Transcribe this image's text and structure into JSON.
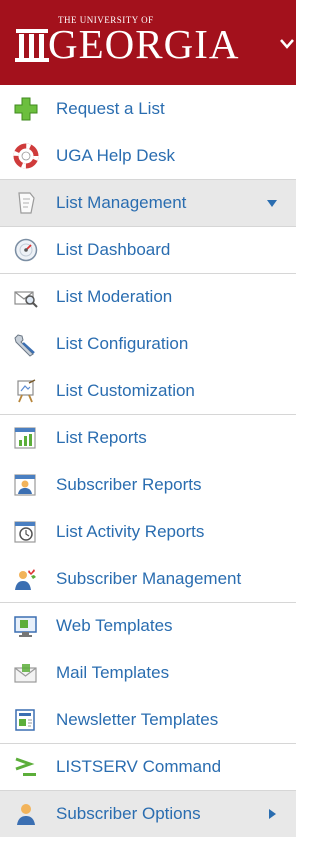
{
  "header": {
    "univ_of": "THE UNIVERSITY OF",
    "georgia": "GEORGIA"
  },
  "menu": [
    {
      "label": "Request a List",
      "icon": "plus-icon"
    },
    {
      "label": "UGA Help Desk",
      "icon": "lifebuoy-icon"
    },
    {
      "label": "List Management",
      "icon": "paper-icon"
    },
    {
      "label": "List Dashboard",
      "icon": "dashboard-gauge-icon"
    },
    {
      "label": "List Moderation",
      "icon": "envelope-magnifier-icon"
    },
    {
      "label": "List Configuration",
      "icon": "wrench-icon"
    },
    {
      "label": "List Customization",
      "icon": "easel-icon"
    },
    {
      "label": "List Reports",
      "icon": "bar-report-icon"
    },
    {
      "label": "Subscriber Reports",
      "icon": "user-report-icon"
    },
    {
      "label": "List Activity Reports",
      "icon": "clock-report-icon"
    },
    {
      "label": "Subscriber Management",
      "icon": "users-icon"
    },
    {
      "label": "Web Templates",
      "icon": "web-template-icon"
    },
    {
      "label": "Mail Templates",
      "icon": "mail-template-icon"
    },
    {
      "label": "Newsletter Templates",
      "icon": "newsletter-template-icon"
    },
    {
      "label": "LISTSERV Command",
      "icon": "command-icon"
    },
    {
      "label": "Subscriber Options",
      "icon": "user-icon"
    }
  ],
  "colors": {
    "brand_red": "#a3111c",
    "link_blue": "#2a6db0",
    "active_bg": "#e8e8e8"
  }
}
